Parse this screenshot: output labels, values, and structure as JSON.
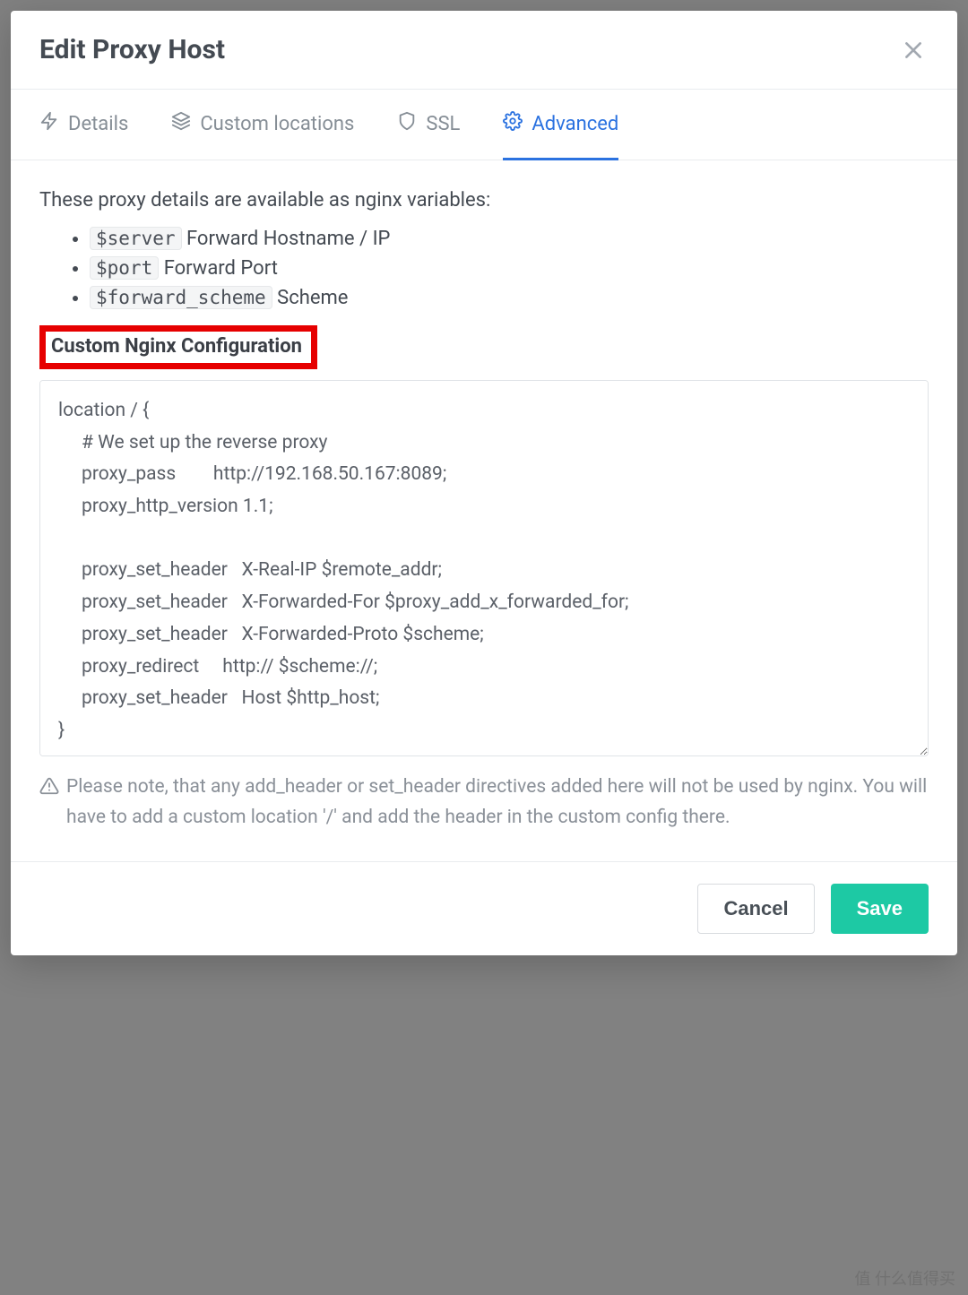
{
  "modal": {
    "title": "Edit Proxy Host"
  },
  "tabs": {
    "details": "Details",
    "custom_locations": "Custom locations",
    "ssl": "SSL",
    "advanced": "Advanced",
    "active": "advanced"
  },
  "body": {
    "intro": "These proxy details are available as nginx variables:",
    "vars": [
      {
        "code": "$server",
        "desc": "Forward Hostname / IP"
      },
      {
        "code": "$port",
        "desc": "Forward Port"
      },
      {
        "code": "$forward_scheme",
        "desc": "Scheme"
      }
    ],
    "config_label": "Custom Nginx Configuration",
    "config_value": "location / {\n     # We set up the reverse proxy\n     proxy_pass        http://192.168.50.167:8089;\n     proxy_http_version 1.1;\n\n     proxy_set_header   X-Real-IP $remote_addr;\n     proxy_set_header   X-Forwarded-For $proxy_add_x_forwarded_for;\n     proxy_set_header   X-Forwarded-Proto $scheme;\n     proxy_redirect     http:// $scheme://;\n     proxy_set_header   Host $http_host;\n}",
    "note": "Please note, that any add_header or set_header directives added here will not be used by nginx. You will have to add a custom location '/' and add the header in the custom config there."
  },
  "footer": {
    "cancel": "Cancel",
    "save": "Save"
  },
  "watermark": "值 什么值得买"
}
